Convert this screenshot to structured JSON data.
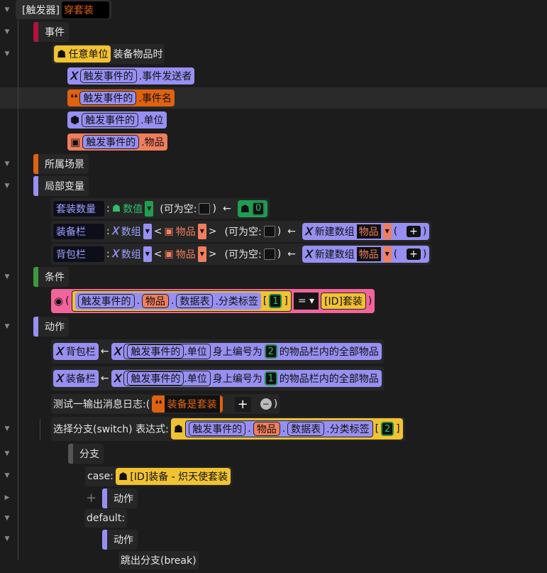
{
  "trigger": {
    "prefix": "[触发器]",
    "name": "穿套装"
  },
  "sections": {
    "event": "事件",
    "scene": "所属场景",
    "locals": "局部变量",
    "condition": "条件",
    "action": "动作"
  },
  "event": {
    "unit": "任意单位",
    "text": "装备物品时",
    "params": [
      {
        "owner": "触发事件的",
        "field": ".事件发送者",
        "color": "#9790f2",
        "icon": "variable-x-icon"
      },
      {
        "owner": "触发事件的",
        "field": ".事件名",
        "color": "#e0620f",
        "icon": "quote-icon"
      },
      {
        "owner": "触发事件的",
        "field": ".单位",
        "color": "#9790f2",
        "icon": "cube-icon"
      },
      {
        "owner": "触发事件的",
        "field": ".物品",
        "color": "#f07e5e",
        "icon": "chest-icon"
      }
    ]
  },
  "locals": [
    {
      "name": "套装数量",
      "type": "数值",
      "nullable": "(可为空:",
      "value": "0"
    },
    {
      "name": "装备栏",
      "type": "数组",
      "sub": "物品",
      "nullable": "(可为空:",
      "init": "新建数组",
      "init_type": "物品"
    },
    {
      "name": "背包栏",
      "type": "数组",
      "sub": "物品",
      "nullable": "(可为空:",
      "init": "新建数组",
      "init_type": "物品"
    }
  ],
  "condition": {
    "owner": "触发事件的",
    "item": "物品",
    "table": "数据表",
    "field": ".分类标签",
    "index": "1",
    "op": "=",
    "rhs": "[ID]套装"
  },
  "actions": [
    {
      "var": "背包栏",
      "owner": "触发事件的",
      "field": ".单位",
      "mid": "身上编号为",
      "num": "2",
      "tail": "的物品栏内的全部物品"
    },
    {
      "var": "装备栏",
      "owner": "触发事件的",
      "field": ".单位",
      "mid": "身上编号为",
      "num": "1",
      "tail": "的物品栏内的全部物品"
    }
  ],
  "log": {
    "label": "测试一输出消息日志:(",
    "value": "装备是套装",
    "close": ")"
  },
  "switch": {
    "label": "选择分支(switch) 表达式:",
    "owner": "触发事件的",
    "item": "物品",
    "table": "数据表",
    "field": ".分类标签",
    "index": "2",
    "branch": "分支",
    "case_label": "case:",
    "case_value": "[ID]装备 - 炽天使套装",
    "action": "动作",
    "default_label": "default:",
    "default_action": "动作",
    "break": "跳出分支(break)"
  },
  "colors": {
    "purple": "#9790f2",
    "orange": "#e0620f",
    "salmon": "#f07e5e",
    "yellow": "#f1c232",
    "green": "#1f9e52",
    "pink": "#f2649c"
  }
}
